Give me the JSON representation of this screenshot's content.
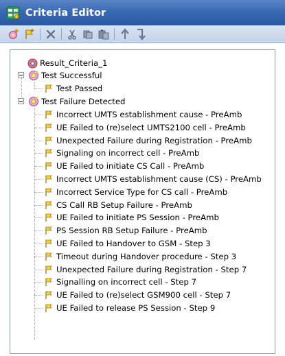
{
  "window": {
    "title": "Criteria Editor",
    "accent_color": "#3a69b4"
  },
  "toolbar": {
    "buttons": [
      {
        "icon": "add-criteria-icon"
      },
      {
        "icon": "add-result-icon"
      },
      {
        "icon": "delete-icon"
      },
      {
        "icon": "cut-icon"
      },
      {
        "icon": "copy-icon"
      },
      {
        "icon": "paste-icon"
      },
      {
        "icon": "move-up-icon"
      },
      {
        "icon": "move-down-icon"
      }
    ]
  },
  "tree": {
    "root": {
      "label": "Result_Criteria_1",
      "icon": "result-criteria-icon"
    },
    "groups": [
      {
        "label": "Test Successful",
        "expanded": true,
        "icon": "success-group-icon",
        "items": [
          "Test Passed"
        ]
      },
      {
        "label": "Test Failure Detected",
        "expanded": true,
        "icon": "failure-group-icon",
        "items": [
          "Incorrect UMTS establishment cause - PreAmb",
          "UE Failed to (re)select UMTS2100 cell - PreAmb",
          "Unexpected Failure during Registration - PreAmb",
          "Signaling on incorrect cell - PreAmb",
          "UE Failed to initiate CS Call - PreAmb",
          "Incorrect UMTS establishment cause (CS) - PreAmb",
          "Incorrect Service Type for CS call - PreAmb",
          "CS Call RB Setup Failure - PreAmb",
          "UE Failed to initiate PS Session - PreAmb",
          "PS Session RB Setup Failure - PreAmb",
          "UE Failed to Handover to GSM - Step 3",
          "Timeout during Handover procedure - Step 3",
          "Unexpected Failure during Registration - Step 7",
          "Signalling on incorrect cell - Step 7",
          "UE Failed to (re)select GSM900 cell - Step 7",
          "UE Failed to release PS Session - Step 9"
        ]
      }
    ]
  }
}
